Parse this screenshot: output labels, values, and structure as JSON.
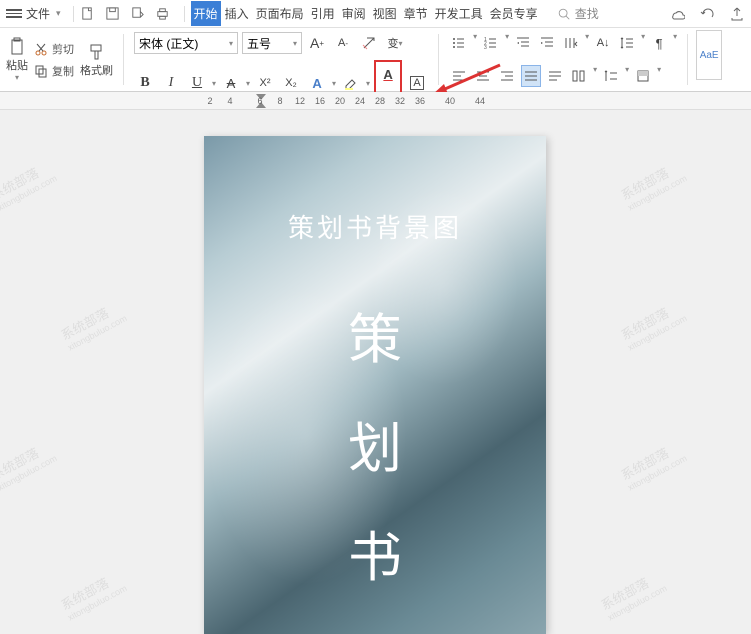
{
  "menubar": {
    "file_label": "文件",
    "tabs": [
      "开始",
      "插入",
      "页面布局",
      "引用",
      "审阅",
      "视图",
      "章节",
      "开发工具",
      "会员专享"
    ],
    "active_tab_index": 0,
    "search_label": "查找"
  },
  "ribbon": {
    "cut_label": "剪切",
    "copy_label": "复制",
    "paste_label": "粘贴",
    "format_painter_label": "格式刷",
    "font_name": "宋体 (正文)",
    "font_size": "五号",
    "bold": "B",
    "italic": "I",
    "underline": "U",
    "strike": "A",
    "super": "X²",
    "sub": "X₂",
    "clear": "A",
    "charfx": "A",
    "grow": "A⁺",
    "shrink": "A⁻",
    "style_preview": "AaE"
  },
  "ruler": {
    "ticks": [
      "2",
      "4",
      "6",
      "8",
      "12",
      "16",
      "20",
      "24",
      "28",
      "32",
      "36",
      "40",
      "44"
    ]
  },
  "document": {
    "title": "策划书背景图",
    "vertical_chars": [
      "策",
      "划",
      "书"
    ]
  },
  "watermark": {
    "main": "系统部落",
    "sub": "xitongbuluo.com"
  }
}
